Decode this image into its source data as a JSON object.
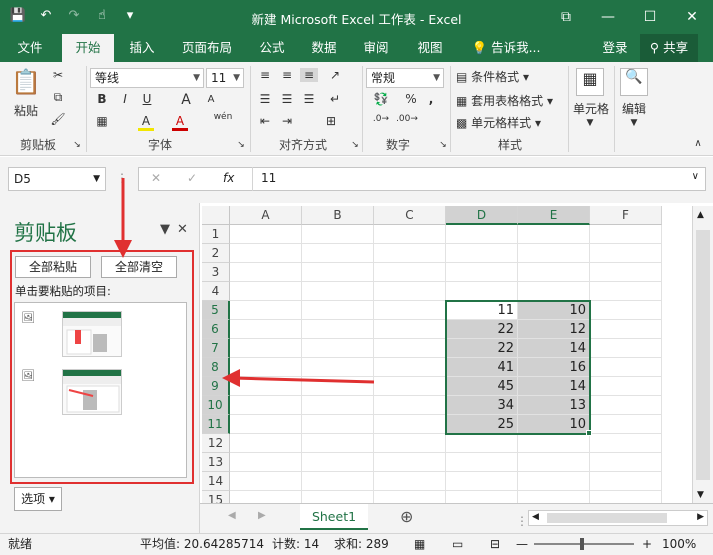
{
  "window": {
    "title": "新建 Microsoft Excel 工作表 - Excel",
    "qat": {
      "save": "💾",
      "undo": "↶",
      "redo": "↷",
      "touch": "☝",
      "more": "▾"
    },
    "controls": {
      "ribbon_opts": "⧉",
      "minimize": "—",
      "maximize": "☐",
      "close": "✕"
    }
  },
  "tabs": [
    "文件",
    "开始",
    "插入",
    "页面布局",
    "公式",
    "数据",
    "审阅",
    "视图"
  ],
  "active_tab": "开始",
  "tellme": "告诉我...",
  "signin": "登录",
  "share": "共享",
  "ribbon": {
    "clipboard": {
      "paste": "粘贴",
      "label": "剪贴板"
    },
    "font": {
      "name": "等线",
      "size": "11",
      "bold": "B",
      "italic": "I",
      "underline": "U",
      "grow": "A",
      "shrink": "A",
      "fill": "A",
      "color": "A",
      "wen": "wén",
      "label": "字体"
    },
    "alignment": {
      "label": "对齐方式"
    },
    "number": {
      "format": "常规",
      "percent": "%",
      "comma": ",",
      "label": "数字"
    },
    "styles": {
      "conditional": "条件格式",
      "table": "套用表格格式",
      "cell": "单元格样式",
      "label": "样式"
    },
    "cells": {
      "label": "单元格"
    },
    "editing": {
      "label": "编辑"
    }
  },
  "formula_bar": {
    "name_box": "D5",
    "cancel": "✕",
    "enter": "✓",
    "fx": "fx",
    "value": "11"
  },
  "clipboard_pane": {
    "title": "剪贴板",
    "paste_all": "全部粘贴",
    "clear_all": "全部清空",
    "hint": "单击要粘贴的项目:",
    "options": "选项"
  },
  "sheet": {
    "columns": [
      "A",
      "B",
      "C",
      "D",
      "E",
      "F"
    ],
    "rows": [
      "1",
      "2",
      "3",
      "4",
      "5",
      "6",
      "7",
      "8",
      "9",
      "10",
      "11",
      "12",
      "13",
      "14",
      "15"
    ],
    "data_d": [
      "11",
      "22",
      "22",
      "41",
      "45",
      "34",
      "25"
    ],
    "data_e": [
      "10",
      "12",
      "14",
      "16",
      "14",
      "13",
      "10"
    ],
    "tab_name": "Sheet1",
    "add_sheet": "⊕"
  },
  "status": {
    "ready": "就绪",
    "average": "平均值: 20.64285714",
    "count": "计数: 14",
    "sum": "求和: 289",
    "zoom": "100%"
  },
  "colors": {
    "accent": "#217346",
    "annotation": "#e03030"
  }
}
